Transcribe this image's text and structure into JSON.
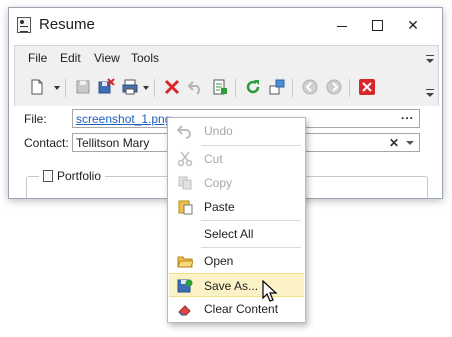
{
  "window": {
    "title": "Resume",
    "icon": "resume-app-icon",
    "controls": [
      "minimize",
      "maximize",
      "close"
    ]
  },
  "menu": {
    "items": [
      "File",
      "Edit",
      "View",
      "Tools"
    ]
  },
  "toolbar": {
    "buttons": [
      {
        "name": "new-document-icon",
        "has_dropdown": true
      },
      {
        "name": "save-icon",
        "enabled": false
      },
      {
        "name": "save-close-icon"
      },
      {
        "name": "print-icon",
        "has_dropdown": true
      },
      {
        "name": "delete-icon"
      },
      {
        "name": "undo-icon",
        "enabled": false
      },
      {
        "name": "export-icon"
      },
      {
        "name": "refresh-icon"
      },
      {
        "name": "layout-icon"
      },
      {
        "name": "previous-icon",
        "enabled": false
      },
      {
        "name": "next-icon",
        "enabled": false
      },
      {
        "name": "close-red-icon"
      }
    ]
  },
  "form": {
    "file_label": "File:",
    "file_value": "screenshot_1.png",
    "file_button": "...",
    "contact_label": "Contact:",
    "contact_value": "Tellitson Mary",
    "clear_glyph": "✕",
    "group_title": "Portfolio"
  },
  "context_menu": {
    "items": [
      {
        "label": "Undo",
        "icon": "undo-icon",
        "enabled": false
      },
      {
        "label": "Cut",
        "icon": "scissors-icon",
        "enabled": false
      },
      {
        "label": "Copy",
        "icon": "copy-icon",
        "enabled": false
      },
      {
        "label": "Paste",
        "icon": "paste-icon",
        "enabled": true
      },
      {
        "label": "Select All",
        "icon": "",
        "enabled": true
      },
      {
        "label": "Open",
        "icon": "folder-icon",
        "enabled": true
      },
      {
        "label": "Save As...",
        "icon": "save-as-icon",
        "enabled": true,
        "hover": true
      },
      {
        "label": "Clear Content",
        "icon": "eraser-icon",
        "enabled": true
      }
    ]
  },
  "colors": {
    "hover_bg": "#fcf2c8",
    "link": "#1f5fbf",
    "disabled_text": "#a6a6a6"
  }
}
